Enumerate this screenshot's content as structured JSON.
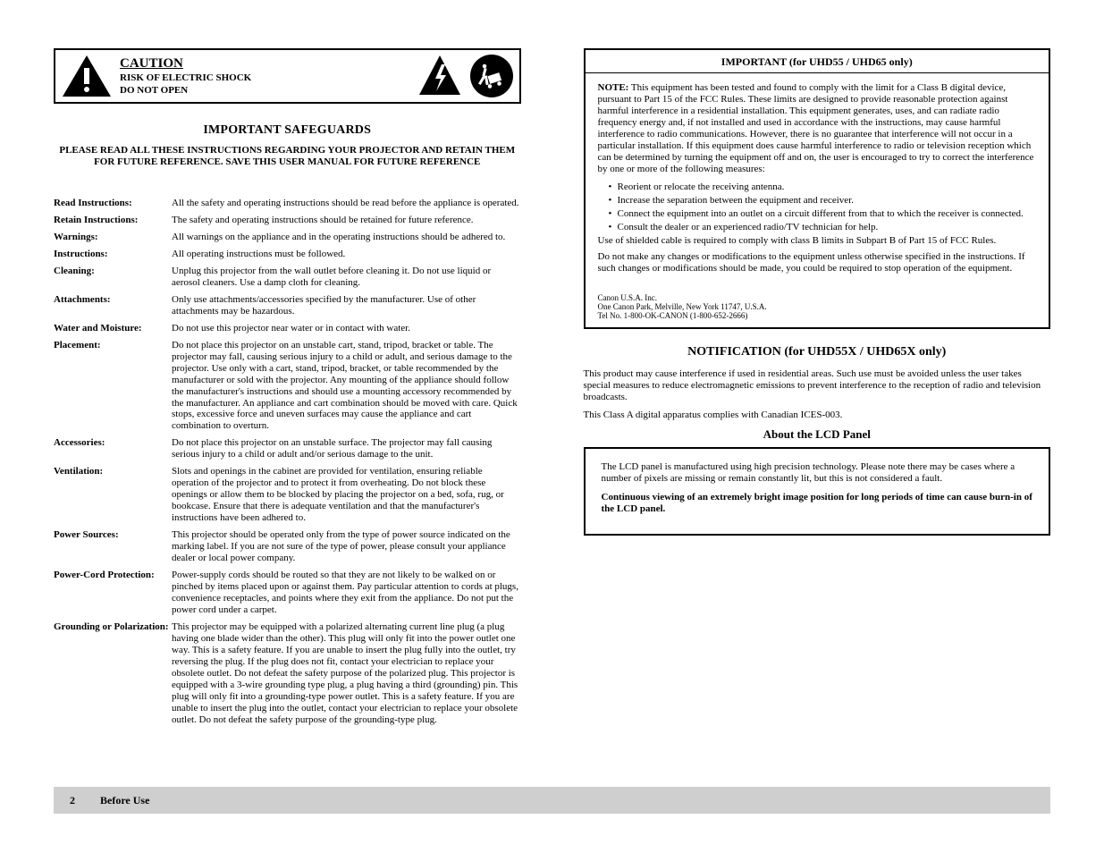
{
  "warning": {
    "title": "CAUTION",
    "sub": "RISK OF ELECTRIC SHOCK",
    "sub2": "DO NOT OPEN"
  },
  "instr": {
    "h1": "IMPORTANT SAFEGUARDS",
    "h2": "PLEASE READ ALL THESE INSTRUCTIONS REGARDING YOUR PROJECTOR AND RETAIN THEM FOR FUTURE REFERENCE. SAVE THIS USER MANUAL FOR FUTURE REFERENCE",
    "items": [
      {
        "k": "Read Instructions:",
        "v": "All the safety and operating instructions should be read before the appliance is operated."
      },
      {
        "k": "Retain Instructions:",
        "v": "The safety and operating instructions should be retained for future reference."
      },
      {
        "k": "Warnings:",
        "v": "All warnings on the appliance and in the operating instructions should be adhered to."
      },
      {
        "k": "Instructions:",
        "v": "All operating instructions must be followed."
      },
      {
        "k": "Cleaning:",
        "v": "Unplug this projector from the wall outlet before cleaning it. Do not use liquid or aerosol cleaners. Use a damp cloth for cleaning."
      },
      {
        "k": "Attachments:",
        "v": "Only use attachments/accessories specified by the manufacturer. Use of other attachments may be hazardous."
      },
      {
        "k": "Water and Moisture:",
        "v": "Do not use this projector near water or in contact with water."
      },
      {
        "k": "Placement:",
        "v": "Do not place this projector on an unstable cart, stand, tripod, bracket or table. The projector may fall, causing serious injury to a child or adult, and serious damage to the projector. Use only with a cart, stand, tripod, bracket, or table recommended by the manufacturer or sold with the projector. Any mounting of the appliance should follow the manufacturer's instructions and should use a mounting accessory recommended by the manufacturer. An appliance and cart combination should be moved with care. Quick stops, excessive force and uneven surfaces may cause the appliance and cart combination to overturn."
      },
      {
        "k": "Accessories:",
        "v": "Do not place this projector on an unstable surface. The projector may fall causing serious injury to a child or adult and/or serious damage to the unit."
      },
      {
        "k": "Ventilation:",
        "v": "Slots and openings in the cabinet are provided for ventilation, ensuring reliable operation of the projector and to protect it from overheating. Do not block these openings or allow them to be blocked by placing the projector on a bed, sofa, rug, or bookcase. Ensure that there is adequate ventilation and that the manufacturer's instructions have been adhered to."
      },
      {
        "k": "Power Sources:",
        "v": "This projector should be operated only from the type of power source indicated on the marking label. If you are not sure of the type of power, please consult your appliance dealer or local power company."
      },
      {
        "k": "Power-Cord Protection:",
        "v": "Power-supply cords should be routed so that they are not likely to be walked on or pinched by items placed upon or against them. Pay particular attention to cords at plugs, convenience receptacles, and points where they exit from the appliance. Do not put the power cord under a carpet."
      },
      {
        "k": "Grounding or Polarization:",
        "v": "This projector may be equipped with a polarized alternating current line plug (a plug having one blade wider than the other). This plug will only fit into the power outlet one way. This is a safety feature. If you are unable to insert the plug fully into the outlet, try reversing the plug. If the plug does not fit, contact your electrician to replace your obsolete outlet. Do not defeat the safety purpose of the polarized plug. This projector is equipped with a 3-wire grounding type plug, a plug having a third (grounding) pin. This plug will only fit into a grounding-type power outlet. This is a safety feature. If you are unable to insert the plug into the outlet, contact your electrician to replace your obsolete outlet. Do not defeat the safety purpose of the grounding-type plug."
      }
    ]
  },
  "fcc": {
    "title": "IMPORTANT (for UHD55 / UHD65 only)",
    "note_title": "NOTE:",
    "note_body": "This equipment has been tested and found to comply with the limit for a Class B digital device, pursuant to Part 15 of the FCC Rules. These limits are designed to provide reasonable protection against harmful interference in a residential installation. This equipment generates, uses, and can radiate radio frequency energy and, if not installed and used in accordance with the instructions, may cause harmful interference to radio communications. However, there is no guarantee that interference will not occur in a particular installation. If this equipment does cause harmful interference to radio or television reception which can be determined by turning the equipment off and on, the user is encouraged to try to correct the interference by one or more of the following measures:",
    "bullets": [
      "Reorient or relocate the receiving antenna.",
      "Increase the separation between the equipment and receiver.",
      "Connect the equipment into an outlet on a circuit different from that to which the receiver is connected.",
      "Consult the dealer or an experienced radio/TV technician for help."
    ],
    "shielded": "Use of shielded cable is required to comply with class B limits in Subpart B of Part 15 of FCC Rules.",
    "changes": "Do not make any changes or modifications to the equipment unless otherwise specified in the instructions. If such changes or modifications should be made, you could be required to stop operation of the equipment.",
    "model": "Canon U.S.A. Inc.",
    "addr": "One Canon Park, Melville, New York 11747, U.S.A.",
    "tel": "Tel No. 1-800-OK-CANON (1-800-652-2666)"
  },
  "classA": {
    "title": "NOTIFICATION (for UHD55X / UHD65X only)",
    "p1": "This product may cause interference if used in residential areas. Such use must be avoided unless the user takes special measures to reduce electromagnetic emissions to prevent interference to the reception of radio and television broadcasts.",
    "p2": "This Class A digital apparatus complies with Canadian ICES-003."
  },
  "lamp": {
    "title": "About the LCD Panel",
    "body": "The LCD panel is manufactured using high precision technology. Please note there may be cases where a number of pixels are missing or remain constantly lit, but this is not considered a fault.",
    "body2": "Continuous viewing of an extremely bright image position for long periods of time can cause burn-in of the LCD panel."
  },
  "footer": {
    "page": "2",
    "section": "Before Use"
  }
}
